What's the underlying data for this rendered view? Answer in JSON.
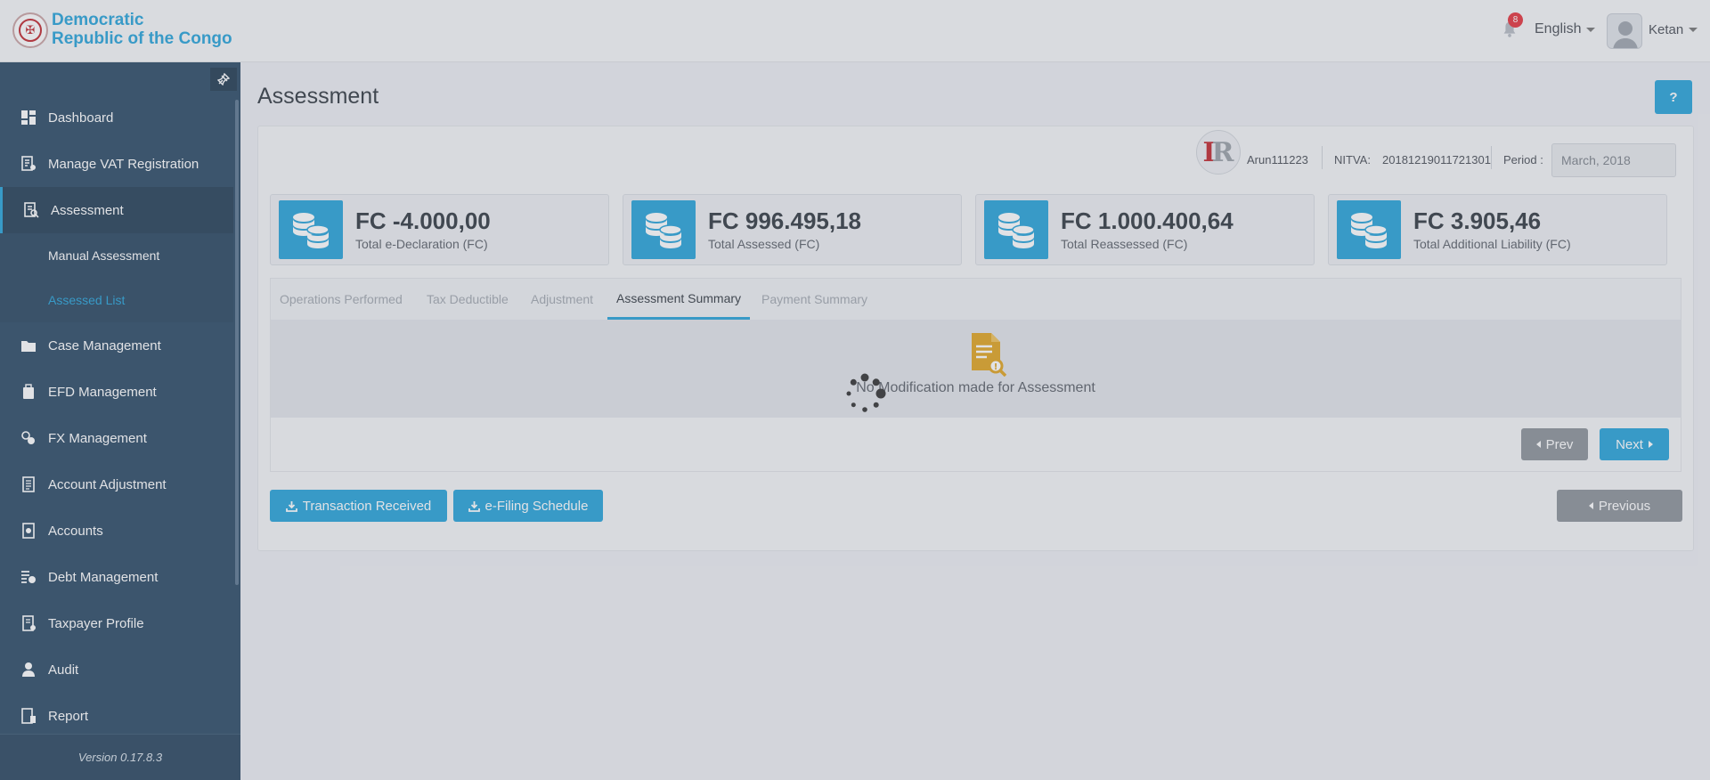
{
  "header": {
    "brand_line1": "Democratic",
    "brand_line2": "Republic of the Congo",
    "notification_count": "8",
    "language": "English",
    "user_name": "Ketan"
  },
  "sidebar": {
    "items": [
      {
        "label": "Dashboard"
      },
      {
        "label": "Manage VAT Registration"
      },
      {
        "label": "Assessment"
      },
      {
        "label": "Manual Assessment"
      },
      {
        "label": "Assessed List"
      },
      {
        "label": "Case Management"
      },
      {
        "label": "EFD Management"
      },
      {
        "label": "FX Management"
      },
      {
        "label": "Account Adjustment"
      },
      {
        "label": "Accounts"
      },
      {
        "label": "Debt Management"
      },
      {
        "label": "Taxpayer Profile"
      },
      {
        "label": "Audit"
      },
      {
        "label": "Report"
      }
    ],
    "version": "Version 0.17.8.3"
  },
  "page": {
    "title": "Assessment",
    "help_label": "?"
  },
  "taxpayer": {
    "username": "Arun111223",
    "nitva_label": "NITVA:",
    "nitva_value": "20181219011721301",
    "period_label": "Period :",
    "period_value": "March, 2018"
  },
  "stats": [
    {
      "value": "FC -4.000,00",
      "label": "Total e-Declaration (FC)"
    },
    {
      "value": "FC 996.495,18",
      "label": "Total Assessed (FC)"
    },
    {
      "value": "FC 1.000.400,64",
      "label": "Total Reassessed (FC)"
    },
    {
      "value": "FC 3.905,46",
      "label": "Total Additional Liability (FC)"
    }
  ],
  "tabs": [
    {
      "label": "Operations Performed"
    },
    {
      "label": "Tax Deductible"
    },
    {
      "label": "Adjustment"
    },
    {
      "label": "Assessment Summary"
    },
    {
      "label": "Payment Summary"
    }
  ],
  "content": {
    "empty_message": "No Modification made for Assessment"
  },
  "pager": {
    "prev_label": "Prev",
    "next_label": "Next"
  },
  "actions": {
    "transaction_received": "Transaction Received",
    "efiling_schedule": "e-Filing Schedule",
    "previous": "Previous"
  },
  "colors": {
    "accent": "#27a3d9",
    "sidebar": "#2c4b66",
    "badge": "#e4343d",
    "doc_icon": "#e0a421"
  }
}
